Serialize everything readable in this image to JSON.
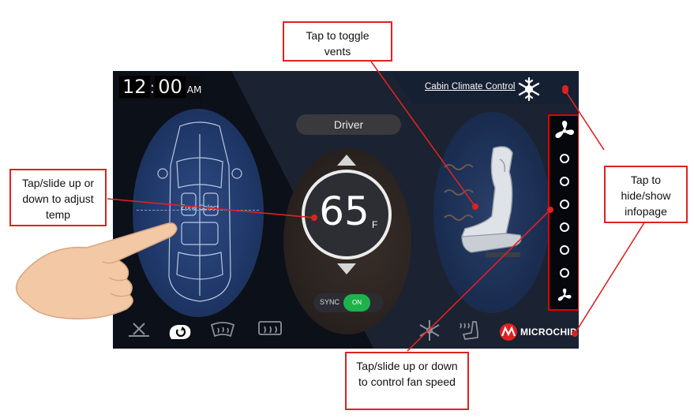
{
  "clock": {
    "hours": "12",
    "separator": ":",
    "minutes": "00",
    "ampm": "AM"
  },
  "header": {
    "title": "Cabin Climate Control",
    "icon": "climate-snowflake-sun-icon"
  },
  "zone": {
    "label": "Zone Select"
  },
  "driver": {
    "label": "Driver"
  },
  "temperature": {
    "value": "65",
    "unit": "F"
  },
  "sync": {
    "label": "SYNC",
    "state": "ON"
  },
  "fan": {
    "levels_shown": 6,
    "top_icon": "fan-large-icon",
    "bottom_icon": "fan-small-icon"
  },
  "bottom_bar": {
    "left_icons": [
      "defrost-rear-icon",
      "recirculate-icon",
      "windshield-defrost-icon",
      "rear-window-heat-icon"
    ],
    "right_icons": [
      "ac-snowflake-icon",
      "seat-heat-icon"
    ],
    "brand": "MICROCHIP"
  },
  "callouts": {
    "vents": "Tap to toggle vents",
    "temp": "Tap/slide up or down to adjust temp",
    "infopage": "Tap to hide/show infopage",
    "fan": "Tap/slide up or down to control fan speed"
  },
  "colors": {
    "callout_border": "#dd2222",
    "sync_on": "#1eb34a",
    "screen_bg": "#05070c",
    "zone_oval": "#1f3767",
    "brand_red": "#e02020"
  }
}
